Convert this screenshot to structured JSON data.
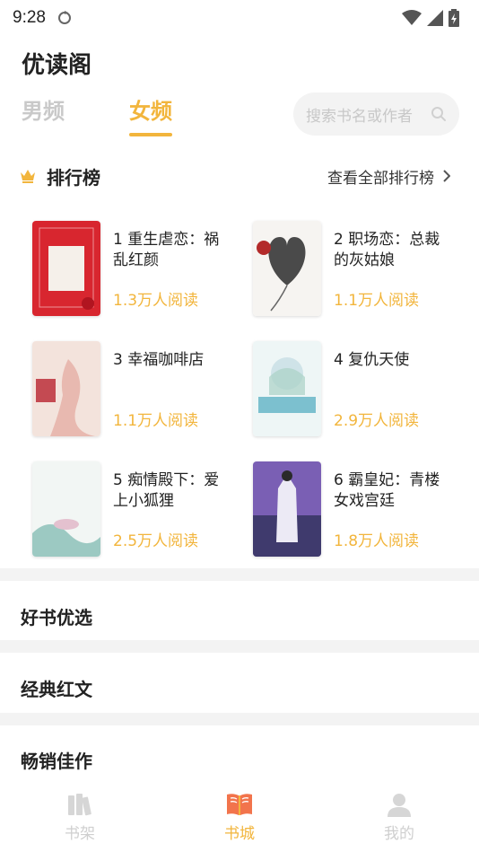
{
  "status_bar": {
    "time": "9:28"
  },
  "app_title": "优读阁",
  "tabs": [
    {
      "label": "男频",
      "active": false
    },
    {
      "label": "女频",
      "active": true
    }
  ],
  "search": {
    "placeholder": "搜索书名或作者"
  },
  "ranking": {
    "title": "排行榜",
    "view_all": "查看全部排行榜",
    "books": [
      {
        "title": "1 重生虐恋：祸乱红颜",
        "reads": "1.3万人阅读"
      },
      {
        "title": "2 职场恋：总裁的灰姑娘",
        "reads": "1.1万人阅读"
      },
      {
        "title": "3 幸福咖啡店",
        "reads": "1.1万人阅读"
      },
      {
        "title": "4 复仇天使",
        "reads": "2.9万人阅读"
      },
      {
        "title": "5 痴情殿下：爱上小狐狸",
        "reads": "2.5万人阅读"
      },
      {
        "title": "6 霸皇妃：青楼女戏宫廷",
        "reads": "1.8万人阅读"
      }
    ]
  },
  "sections": [
    "好书优选",
    "经典红文",
    "畅销佳作"
  ],
  "bottom_nav": [
    {
      "label": "书架",
      "icon": "bookshelf-icon",
      "active": false
    },
    {
      "label": "书城",
      "icon": "book-store-icon",
      "active": true
    },
    {
      "label": "我的",
      "icon": "profile-icon",
      "active": false
    }
  ],
  "colors": {
    "accent": "#f2b53c",
    "inactive": "#c9c9c9",
    "divider": "#f3f3f3"
  }
}
